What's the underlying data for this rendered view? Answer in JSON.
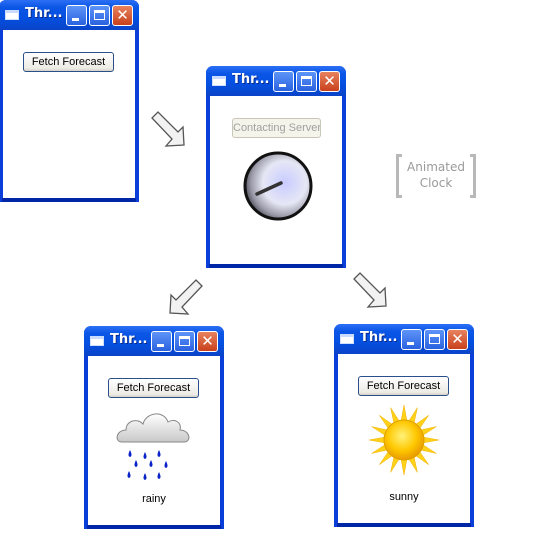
{
  "windows": [
    {
      "title": "Thr...",
      "button_label": "Fetch Forecast",
      "state": "initial"
    },
    {
      "title": "Thr...",
      "button_label": "Contacting Server",
      "button_disabled": true,
      "state": "waiting",
      "indicator": "clock-icon"
    },
    {
      "title": "Thr...",
      "button_label": "Fetch Forecast",
      "state": "result",
      "weather_icon": "rain-cloud-icon",
      "caption": "rainy"
    },
    {
      "title": "Thr...",
      "button_label": "Fetch Forecast",
      "state": "result",
      "weather_icon": "sun-icon",
      "caption": "sunny"
    }
  ],
  "annotation": {
    "line1": "Animated",
    "line2": "Clock"
  },
  "arrows": [
    "arrow-down-right",
    "arrow-down-left",
    "arrow-down-right"
  ],
  "colors": {
    "window_frame": "#0a3ed8",
    "close_button": "#d0512a",
    "rain_drop": "#0a22c8",
    "sun": "#ffc800"
  }
}
